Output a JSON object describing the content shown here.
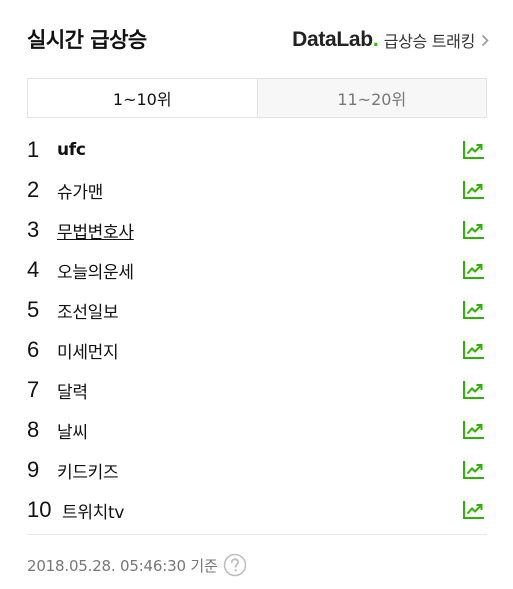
{
  "header": {
    "title": "실시간 급상승",
    "datalab_logo": "DataLab",
    "datalab_dot": ".",
    "datalab_text": "급상승 트래킹"
  },
  "tabs": [
    {
      "label": "1~10위",
      "active": true
    },
    {
      "label": "11~20위",
      "active": false
    }
  ],
  "rankings": [
    {
      "rank": "1",
      "keyword": "ufc"
    },
    {
      "rank": "2",
      "keyword": "슈가맨"
    },
    {
      "rank": "3",
      "keyword": "무법변호사"
    },
    {
      "rank": "4",
      "keyword": "오늘의운세"
    },
    {
      "rank": "5",
      "keyword": "조선일보"
    },
    {
      "rank": "6",
      "keyword": "미세먼지"
    },
    {
      "rank": "7",
      "keyword": "달력"
    },
    {
      "rank": "8",
      "keyword": "날씨"
    },
    {
      "rank": "9",
      "keyword": "키드키즈"
    },
    {
      "rank": "10",
      "keyword": "트위치tv"
    }
  ],
  "footer": {
    "timestamp": "2018.05.28. 05:46:30 기준"
  },
  "colors": {
    "accent_green": "#1ec800",
    "trend_icon": "#2db400"
  },
  "icons": {
    "trend": "trend-up-chart-icon",
    "chevron": "chevron-right-icon",
    "help": "question-circle-icon"
  }
}
